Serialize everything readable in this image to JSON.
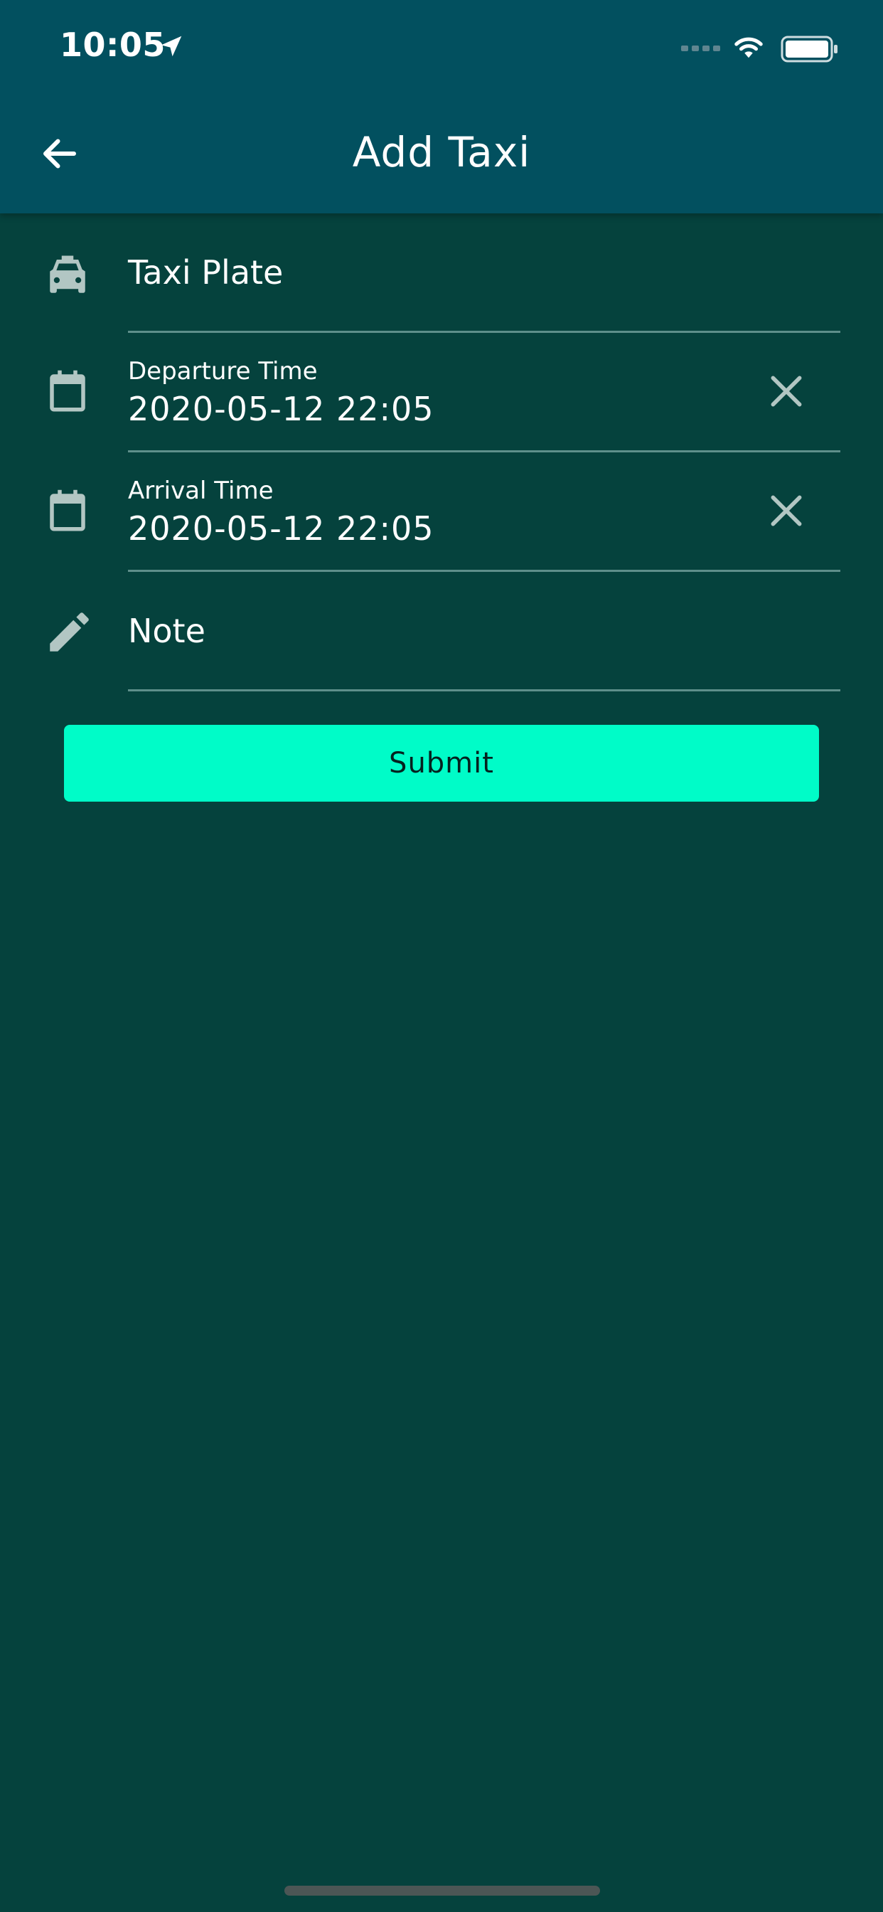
{
  "status_bar": {
    "time": "10:05",
    "icons": [
      "location-arrow-icon",
      "signal-icon",
      "wifi-icon",
      "battery-icon"
    ]
  },
  "header": {
    "title": "Add Taxi",
    "back_icon": "arrow-left-icon",
    "background": "#02505f"
  },
  "form": {
    "taxi_plate": {
      "placeholder": "Taxi Plate",
      "value": "",
      "icon": "taxi-icon"
    },
    "departure": {
      "label": "Departure Time",
      "value": "2020-05-12 22:05",
      "icon": "calendar-icon",
      "clear_icon": "close-icon"
    },
    "arrival": {
      "label": "Arrival Time",
      "value": "2020-05-12 22:05",
      "icon": "calendar-icon",
      "clear_icon": "close-icon"
    },
    "note": {
      "placeholder": "Note",
      "value": "",
      "icon": "pencil-icon"
    },
    "submit_label": "Submit"
  },
  "colors": {
    "background": "#05423d",
    "accent": "#00fcc8",
    "icon": "#b2c6c3"
  }
}
